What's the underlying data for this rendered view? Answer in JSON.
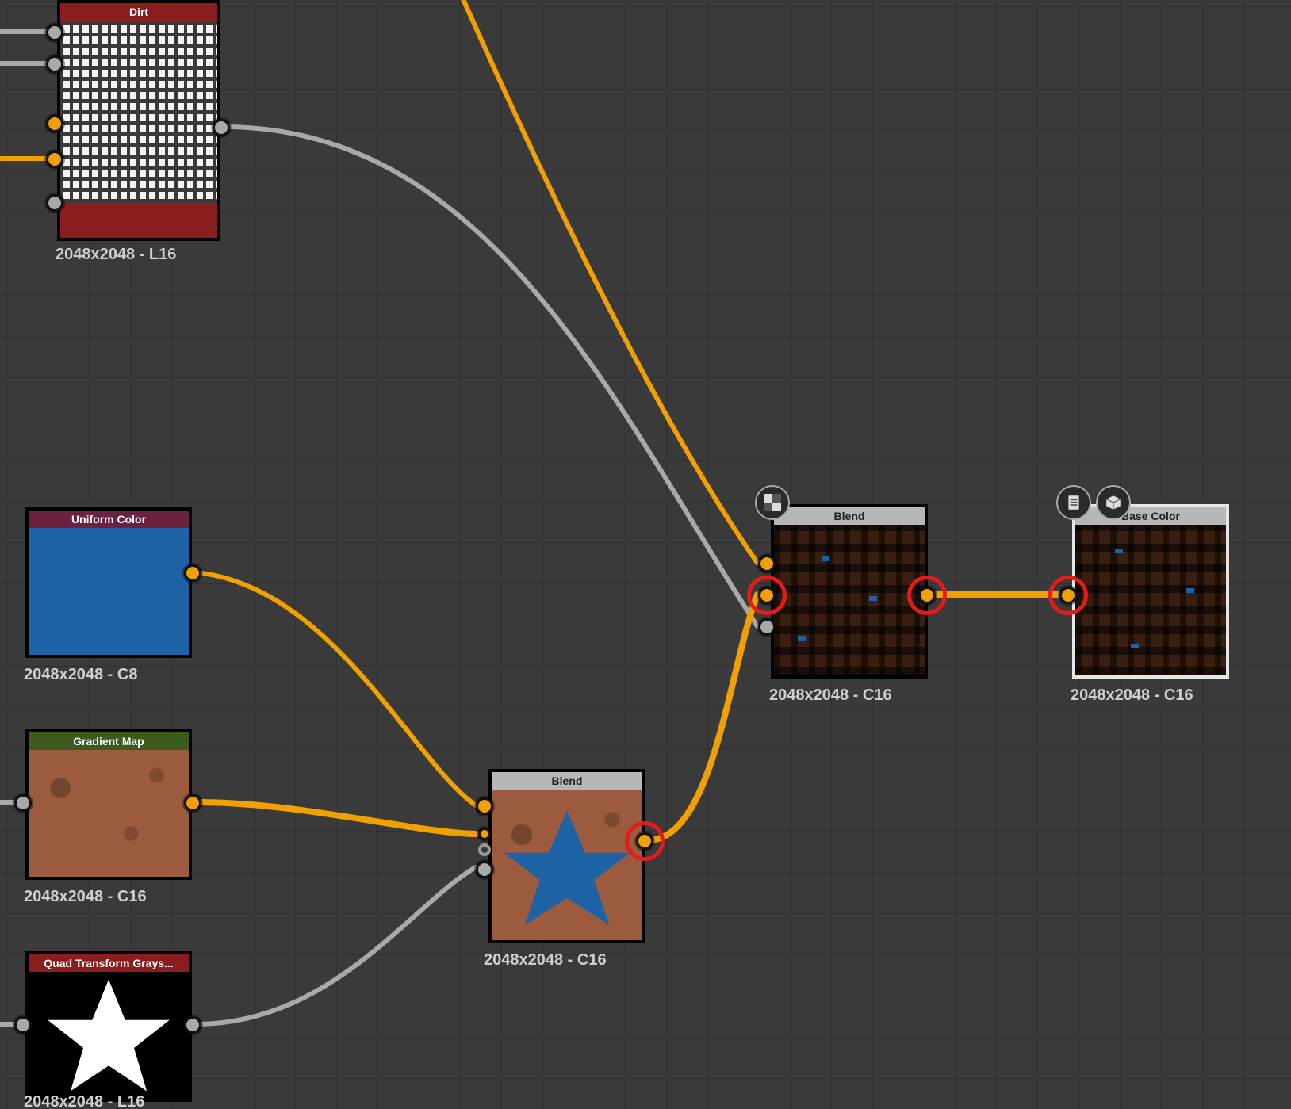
{
  "nodes": {
    "dirt": {
      "title": "Dirt",
      "caption": "2048x2048 - L16",
      "header_color": "#8a1d1d",
      "footer_color": "#8a1d1d"
    },
    "uniform_color": {
      "title": "Uniform Color",
      "caption": "2048x2048 - C8",
      "header_color": "#6a2240"
    },
    "gradient_map": {
      "title": "Gradient Map",
      "caption": "2048x2048 - C16",
      "header_color": "#3d5a1f"
    },
    "quad_transform": {
      "title": "Quad Transform Grays...",
      "caption": "2048x2048 - L16",
      "header_color": "#8a1d1d"
    },
    "blend1": {
      "title": "Blend",
      "caption": "2048x2048 - C16",
      "header_color": "#b7b7b7"
    },
    "blend2": {
      "title": "Blend",
      "caption": "2048x2048 - C16",
      "header_color": "#b7b7b7"
    },
    "base_color": {
      "title": "Base Color",
      "caption": "2048x2048 - C16",
      "header_color": "#b7b7b7"
    }
  },
  "icons": {
    "checker": "checker-icon",
    "doc": "document-icon",
    "cube": "cube-icon"
  }
}
